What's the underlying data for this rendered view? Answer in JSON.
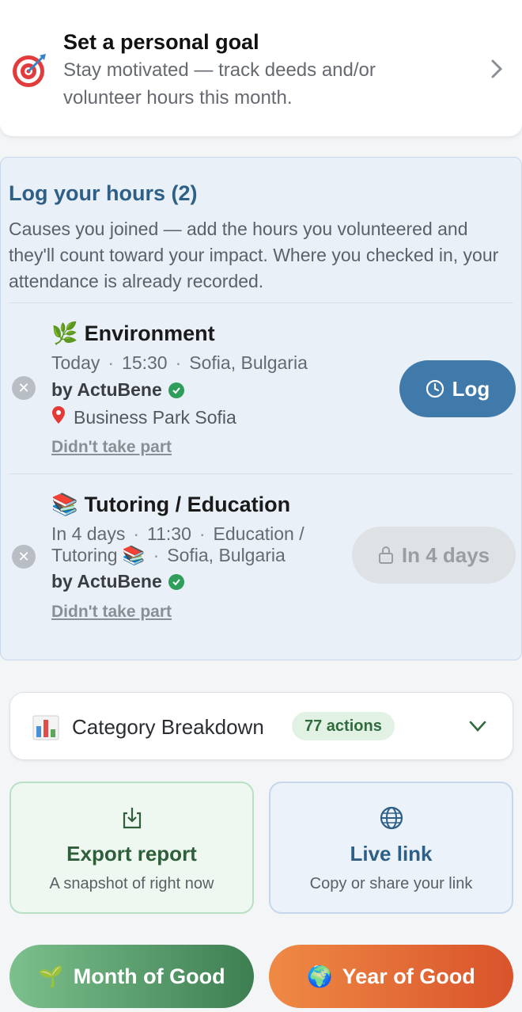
{
  "goal": {
    "title": "Set a personal goal",
    "subtitle": "Stay motivated — track deeds and/or volunteer hours this month."
  },
  "log_hours": {
    "title": "Log your hours (2)",
    "description": "Causes you joined — add the hours you volunteered and they'll count toward your impact. Where you checked in, your attendance is already recorded.",
    "events": [
      {
        "emoji": "🌿",
        "title": "Environment",
        "when": "Today",
        "time": "15:30",
        "location": "Sofia, Bulgaria",
        "organizer": "by ActuBene",
        "place": "Business Park Sofia",
        "skip_label": "Didn't take part",
        "action_label": "Log"
      },
      {
        "emoji": "📚",
        "title": "Tutoring / Education",
        "when": "In 4 days",
        "time": "11:30",
        "category_line1": "Education /",
        "category_line2": "Tutoring 📚",
        "location": "Sofia, Bulgaria",
        "organizer": "by ActuBene",
        "skip_label": "Didn't take part",
        "action_label": "In 4 days"
      }
    ]
  },
  "breakdown": {
    "label": "Category Breakdown",
    "badge": "77 actions"
  },
  "actions": {
    "export_title": "Export report",
    "export_sub": "A snapshot of right now",
    "live_title": "Live link",
    "live_sub": "Copy or share your link"
  },
  "pills": {
    "month_emoji": "🌱",
    "month_label": "Month of Good",
    "year_emoji": "🌍",
    "year_label": "Year of Good"
  },
  "colors": {
    "accent_blue": "#3f7aab",
    "accent_green": "#2f9e5a",
    "year_orange": "#d9532b"
  }
}
